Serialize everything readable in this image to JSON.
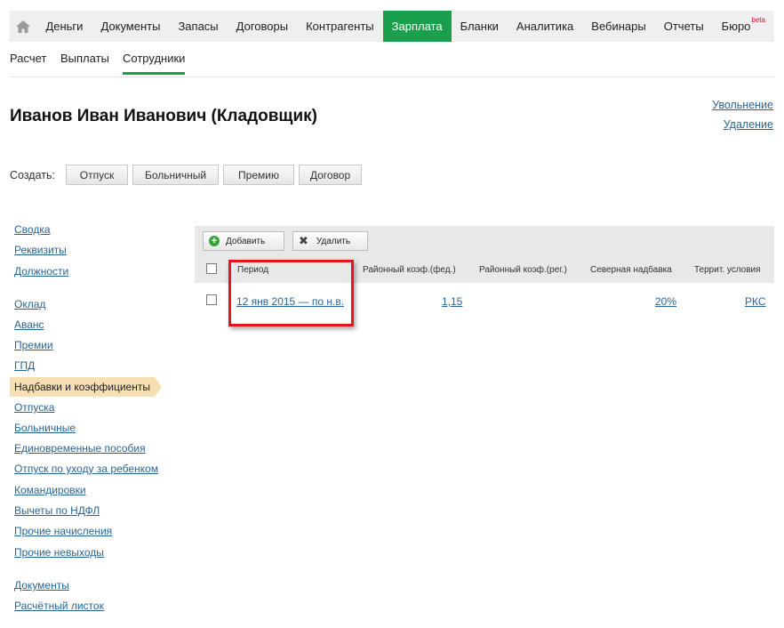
{
  "topnav": {
    "items": [
      "Деньги",
      "Документы",
      "Запасы",
      "Договоры",
      "Контрагенты",
      "Зарплата",
      "Бланки",
      "Аналитика",
      "Вебинары",
      "Отчеты",
      "Бюро"
    ],
    "active": "Зарплата",
    "beta": "beta",
    "accent": "#1aa04c"
  },
  "subnav": {
    "items": [
      "Расчет",
      "Выплаты",
      "Сотрудники"
    ],
    "active": "Сотрудники"
  },
  "employee": {
    "title": "Иванов Иван Иванович (Кладовщик)"
  },
  "actions": {
    "dismiss": "Увольнение",
    "delete": "Удаление"
  },
  "create": {
    "label": "Создать:",
    "buttons": [
      "Отпуск",
      "Больничный",
      "Премию",
      "Договор"
    ]
  },
  "sidebar": {
    "items": [
      "Сводка",
      "Реквизиты",
      "Должности",
      "Оклад",
      "Аванс",
      "Премии",
      "ГПД",
      "Надбавки и коэффициенты",
      "Отпуска",
      "Больничные",
      "Единовременные пособия",
      "Отпуск по уходу за ребенком",
      "Командировки",
      "Вычеты по НДФЛ",
      "Прочие начисления",
      "Прочие невыходы",
      "Документы",
      "Расчётный листок"
    ],
    "active": "Надбавки и коэффициенты"
  },
  "toolbar": {
    "add": "Добавить",
    "remove": "Удалить"
  },
  "table": {
    "columns": [
      "Период",
      "Районный коэф.(фед.)",
      "Районный коэф.(рег.)",
      "Северная надбавка",
      "Террит. условия"
    ],
    "rows": [
      {
        "period": "12 янв 2015 — по н.в.",
        "fed": "1,15",
        "reg": "",
        "north": "20%",
        "terr": "РКС"
      }
    ]
  },
  "highlight_color": "#e2171e"
}
